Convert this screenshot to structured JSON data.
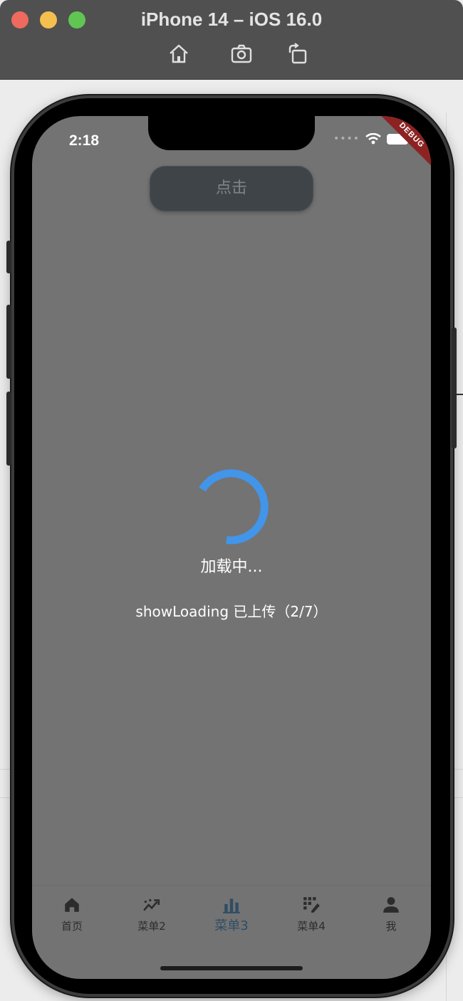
{
  "window": {
    "title": "iPhone 14 – iOS 16.0",
    "toolbar": [
      "home-icon",
      "screenshot-icon",
      "rotate-icon"
    ]
  },
  "status_bar": {
    "time": "2:18",
    "debug_label": "DEBUG"
  },
  "main": {
    "button_label": "点击",
    "loading_label": "加载中...",
    "upload_status": "showLoading 已上传（2/7）",
    "spinner_color": "#4295e8"
  },
  "tabbar": {
    "active_index": 2,
    "active_color": "#2f4d64",
    "items": [
      {
        "label": "首页",
        "icon": "home-icon"
      },
      {
        "label": "菜单2",
        "icon": "trending-icon"
      },
      {
        "label": "菜单3",
        "icon": "bar-chart-icon"
      },
      {
        "label": "菜单4",
        "icon": "grid-edit-icon"
      },
      {
        "label": "我",
        "icon": "person-icon"
      }
    ]
  }
}
